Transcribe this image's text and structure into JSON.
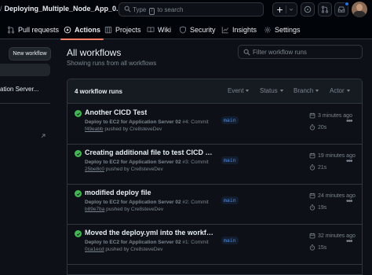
{
  "header": {
    "repo_slash": "/",
    "repo_name": "Deploying_Multiple_Node_App_0...",
    "search_prefix": "Type",
    "search_key": "/",
    "search_suffix": "to search"
  },
  "tabs": [
    {
      "label": "Pull requests",
      "icon": "pull-request-icon"
    },
    {
      "label": "Actions",
      "icon": "play-icon",
      "active": true
    },
    {
      "label": "Projects",
      "icon": "table-icon"
    },
    {
      "label": "Wiki",
      "icon": "book-icon"
    },
    {
      "label": "Security",
      "icon": "shield-icon"
    },
    {
      "label": "Insights",
      "icon": "graph-icon"
    },
    {
      "label": "Settings",
      "icon": "gear-icon"
    }
  ],
  "sidebar": {
    "new_workflow_label": "New workflow",
    "workflow_item": "ation Server..."
  },
  "main": {
    "title": "All workflows",
    "subtitle": "Showing runs from all workflows",
    "filter_placeholder": "Filter workflow runs",
    "run_count": "4 workflow runs",
    "filters": [
      "Event",
      "Status",
      "Branch",
      "Actor"
    ]
  },
  "runs": [
    {
      "title": "Another CICD Test",
      "workflow": "Deploy to EC2 for Application Server 02",
      "run_number": "#4",
      "commit_label": "Commit",
      "sha": "f49eabb",
      "pushed_by": "pushed by Cre8steveDev",
      "branch": "main",
      "time": "3 minutes ago",
      "duration": "20s"
    },
    {
      "title": "Creating additional file to test CICD De...",
      "workflow": "Deploy to EC2 for Application Server 02",
      "run_number": "#3",
      "commit_label": "Commit",
      "sha": "25be8c0",
      "pushed_by": "pushed by Cre8steveDev",
      "branch": "main",
      "time": "19 minutes ago",
      "duration": "21s"
    },
    {
      "title": "modified deploy file",
      "workflow": "Deploy to EC2 for Application Server 02",
      "run_number": "#2",
      "commit_label": "Commit",
      "sha": "b89e7ba",
      "pushed_by": "pushed by Cre8steveDev",
      "branch": "main",
      "time": "24 minutes ago",
      "duration": "19s"
    },
    {
      "title": "Moved the deploy.yml into the workflo...",
      "workflow": "Deploy to EC2 for Application Server 02",
      "run_number": "#1",
      "commit_label": "Commit",
      "sha": "0ca1ecd",
      "pushed_by": "pushed by Cre8steveDev",
      "branch": "main",
      "time": "32 minutes ago",
      "duration": "15s"
    }
  ],
  "colors": {
    "success": "#3fb950",
    "accent_underline": "#f78166",
    "branch_text": "#4493f8"
  }
}
